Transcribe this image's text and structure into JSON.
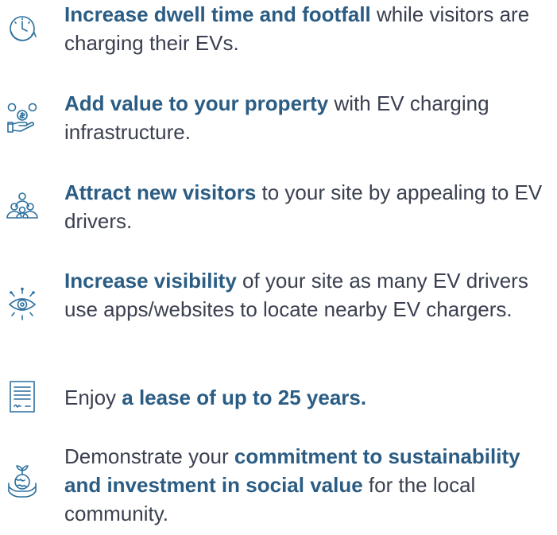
{
  "theme": {
    "accent": "#2b5d84",
    "text": "#3b4050",
    "icon_stroke": "#2b6f9e"
  },
  "benefits": [
    {
      "icon": "clock-arrow-icon",
      "parts": [
        {
          "text": "Increase dwell time and footfall",
          "bold": true
        },
        {
          "text": " while visitors are charging their EVs.",
          "bold": false
        }
      ]
    },
    {
      "icon": "hand-coins-icon",
      "parts": [
        {
          "text": "Add value to your property",
          "bold": true
        },
        {
          "text": " with EV charging infrastructure.",
          "bold": false
        }
      ]
    },
    {
      "icon": "people-group-icon",
      "parts": [
        {
          "text": "Attract new visitors",
          "bold": true
        },
        {
          "text": " to your site by appealing to EV drivers.",
          "bold": false
        }
      ]
    },
    {
      "icon": "eye-visibility-icon",
      "parts": [
        {
          "text": "Increase visibility",
          "bold": true
        },
        {
          "text": " of your site as many EV drivers use apps/websites to locate nearby EV chargers.",
          "bold": false
        }
      ]
    },
    {
      "icon": "lease-document-icon",
      "parts": [
        {
          "text": "Enjoy ",
          "bold": false
        },
        {
          "text": "a lease of up to 25 years.",
          "bold": true
        }
      ]
    },
    {
      "icon": "hand-globe-plant-icon",
      "parts": [
        {
          "text": "Demonstrate your ",
          "bold": false
        },
        {
          "text": "commitment to sustainability and investment in social value",
          "bold": true
        },
        {
          "text": " for the local community.",
          "bold": false
        }
      ]
    }
  ]
}
